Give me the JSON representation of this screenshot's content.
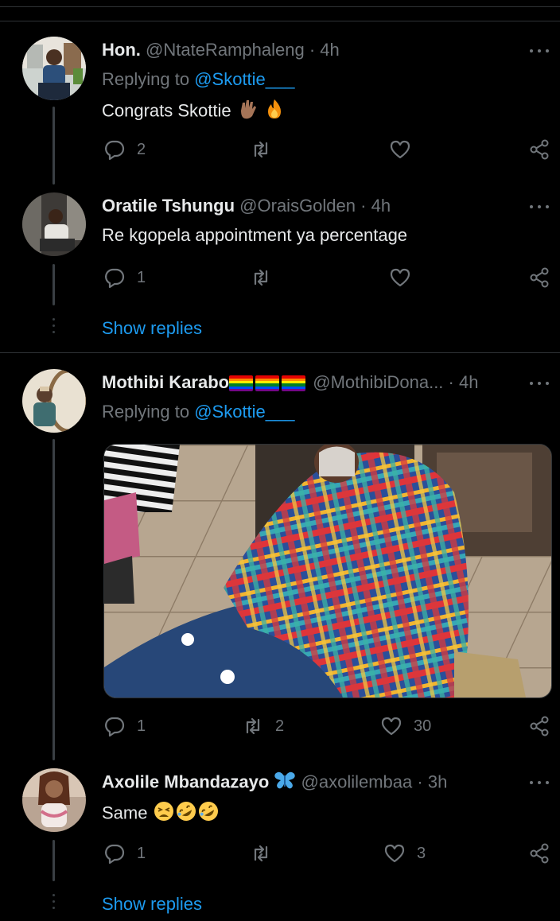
{
  "tweets": [
    {
      "name": "Hon.",
      "handle": "@NtateRamphaleng",
      "sep": "·",
      "time": "4h",
      "replying_prefix": "Replying to",
      "replying_to": "@Skottie___",
      "text": "Congrats Skottie",
      "emojis": [
        "raised-hand-icon",
        "fire-icon"
      ],
      "replies": "2",
      "retweets": "",
      "likes": ""
    },
    {
      "name": "Oratile Tshungu",
      "handle": "@OraisGolden",
      "sep": "·",
      "time": "4h",
      "text": "Re kgopela appointment ya percentage",
      "replies": "1",
      "retweets": "",
      "likes": "",
      "show_replies": "Show replies"
    },
    {
      "name": "Mothibi Karabo",
      "name_flags": 3,
      "handle": "@MothibiDona...",
      "sep": "·",
      "time": "4h",
      "replying_prefix": "Replying to",
      "replying_to": "@Skottie___",
      "media": "photo-woman-in-plaid-blanket",
      "replies": "1",
      "retweets": "2",
      "likes": "30"
    },
    {
      "name": "Axolile Mbandazayo",
      "name_emoji": "butterfly-icon",
      "handle": "@axolilembaa",
      "sep": "·",
      "time": "3h",
      "text": "Same",
      "emojis": [
        "tired-face-icon",
        "rofl-icon",
        "rofl-icon"
      ],
      "replies": "1",
      "retweets": "",
      "likes": "3",
      "show_replies": "Show replies"
    }
  ],
  "colors": {
    "background": "#000000",
    "text": "#e7e9ea",
    "muted": "#71767b",
    "link": "#1d9bf0",
    "divider": "#2f3336"
  }
}
